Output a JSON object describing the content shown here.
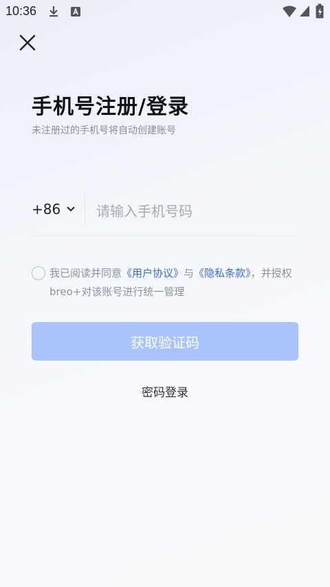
{
  "status_bar": {
    "time": "10:36",
    "left_icons": [
      "download-icon",
      "app-notification-icon"
    ],
    "right_icons": [
      "wifi-icon",
      "signal-icon",
      "battery-icon"
    ]
  },
  "header": {
    "close_icon": "close-icon"
  },
  "login": {
    "title": "手机号注册/登录",
    "subtitle": "未注册过的手机号将自动创建账号",
    "country_code": "+86",
    "phone_placeholder": "请输入手机号码",
    "phone_value": "",
    "agreement": {
      "prefix": "我已阅读并同意",
      "user_agreement": "《用户协议》",
      "connector": "与",
      "privacy_policy": "《隐私条款》",
      "suffix": "，并授权breo+对该账号进行统一管理"
    },
    "get_code_label": "获取验证码",
    "password_login_label": "密码登录"
  },
  "colors": {
    "primary_disabled": "#a9c4fb",
    "link": "#3c6bd8",
    "muted_text": "#8a8f98"
  }
}
